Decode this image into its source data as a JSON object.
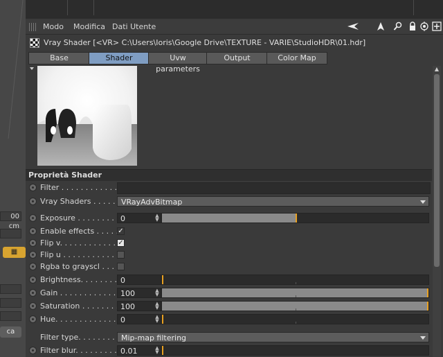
{
  "left_panel": {
    "unit_field": "00 cm",
    "bottom_button": "ca"
  },
  "menubar": {
    "items": [
      "Modo",
      "Modifica",
      "Dati Utente"
    ],
    "icons": [
      "back-arrow-icon",
      "pointer-icon",
      "search-icon",
      "lock-icon",
      "target-icon",
      "add-panel-icon"
    ]
  },
  "title": "Vray Shader [<VR> C:\\Users\\Ioris\\Google Drive\\TEXTURE - VARIE\\StudioHDR\\01.hdr]",
  "tabs": [
    {
      "label": "Base",
      "active": false
    },
    {
      "label": "Shader",
      "active": true
    },
    {
      "label": "Uvw parameters",
      "active": false
    },
    {
      "label": "Output",
      "active": false
    },
    {
      "label": "Color Map",
      "active": false
    }
  ],
  "section_title": "Proprietà Shader",
  "properties": {
    "filter": {
      "label": "Filter . . . . . . . . . . . . .",
      "value": ""
    },
    "vray_shaders": {
      "label": "Vray Shaders . . . . . . .",
      "value": "VRayAdvBitmap"
    },
    "exposure": {
      "label": "Exposure . . . . . . . . . .",
      "value": "0",
      "level": 0.5
    },
    "enable_effects": {
      "label": "Enable effects . . . . . .",
      "state": "checked"
    },
    "flip_v": {
      "label": "Flip v. . . . . . . . . . . . . .",
      "state": "mixed"
    },
    "flip_u": {
      "label": "Flip u . . . . . . . . . . . . .",
      "state": "unchecked"
    },
    "rgba_gray": {
      "label": "Rgba to grayscl . . . . . .",
      "state": "unchecked"
    },
    "brightness": {
      "label": "Brightness. . . . . . . . . .",
      "value": "0",
      "level": 0
    },
    "gain": {
      "label": "Gain . . . . . . . . . . . . . .",
      "value": "100",
      "level": 1
    },
    "saturation": {
      "label": "Saturation . . . . . . . . . .",
      "value": "100",
      "level": 1
    },
    "hue": {
      "label": "Hue. . . . . . . . . . . . . . .",
      "value": "0",
      "level": 0
    },
    "filter_type": {
      "label": "Filter type. . . . . . . . . .",
      "value": "Mip-map filtering"
    },
    "filter_blur": {
      "label": "Filter blur. . . . . . . . . .",
      "value": "0.01",
      "level": 0
    }
  },
  "colors": {
    "accent_tab": "#7f9dc2",
    "slider_handle": "#e8a020"
  }
}
